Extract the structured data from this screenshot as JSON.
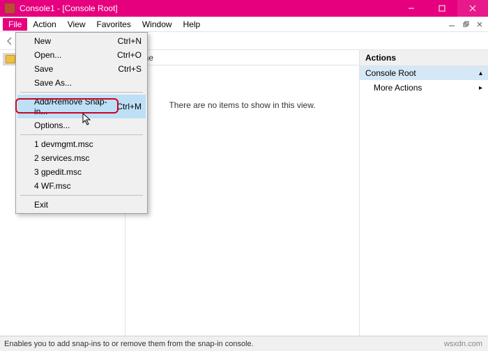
{
  "titlebar": {
    "title": "Console1 - [Console Root]"
  },
  "menubar": {
    "items": [
      "File",
      "Action",
      "View",
      "Favorites",
      "Window",
      "Help"
    ]
  },
  "tree": {
    "root_label": "Console Root"
  },
  "list": {
    "column_header": "Name",
    "empty_text": "There are no items to show in this view."
  },
  "actions": {
    "title": "Actions",
    "subtitle": "Console Root",
    "more": "More Actions"
  },
  "dropdown": {
    "new": {
      "label": "New",
      "shortcut": "Ctrl+N"
    },
    "open": {
      "label": "Open...",
      "shortcut": "Ctrl+O"
    },
    "save": {
      "label": "Save",
      "shortcut": "Ctrl+S"
    },
    "saveas": {
      "label": "Save As..."
    },
    "addremove": {
      "label": "Add/Remove Snap-in...",
      "shortcut": "Ctrl+M"
    },
    "options": {
      "label": "Options..."
    },
    "recent1": {
      "label": "1 devmgmt.msc"
    },
    "recent2": {
      "label": "2 services.msc"
    },
    "recent3": {
      "label": "3 gpedit.msc"
    },
    "recent4": {
      "label": "4 WF.msc"
    },
    "exit": {
      "label": "Exit"
    }
  },
  "statusbar": {
    "text": "Enables you to add snap-ins to or remove them from the snap-in console."
  },
  "watermark": "wsxdn.com"
}
